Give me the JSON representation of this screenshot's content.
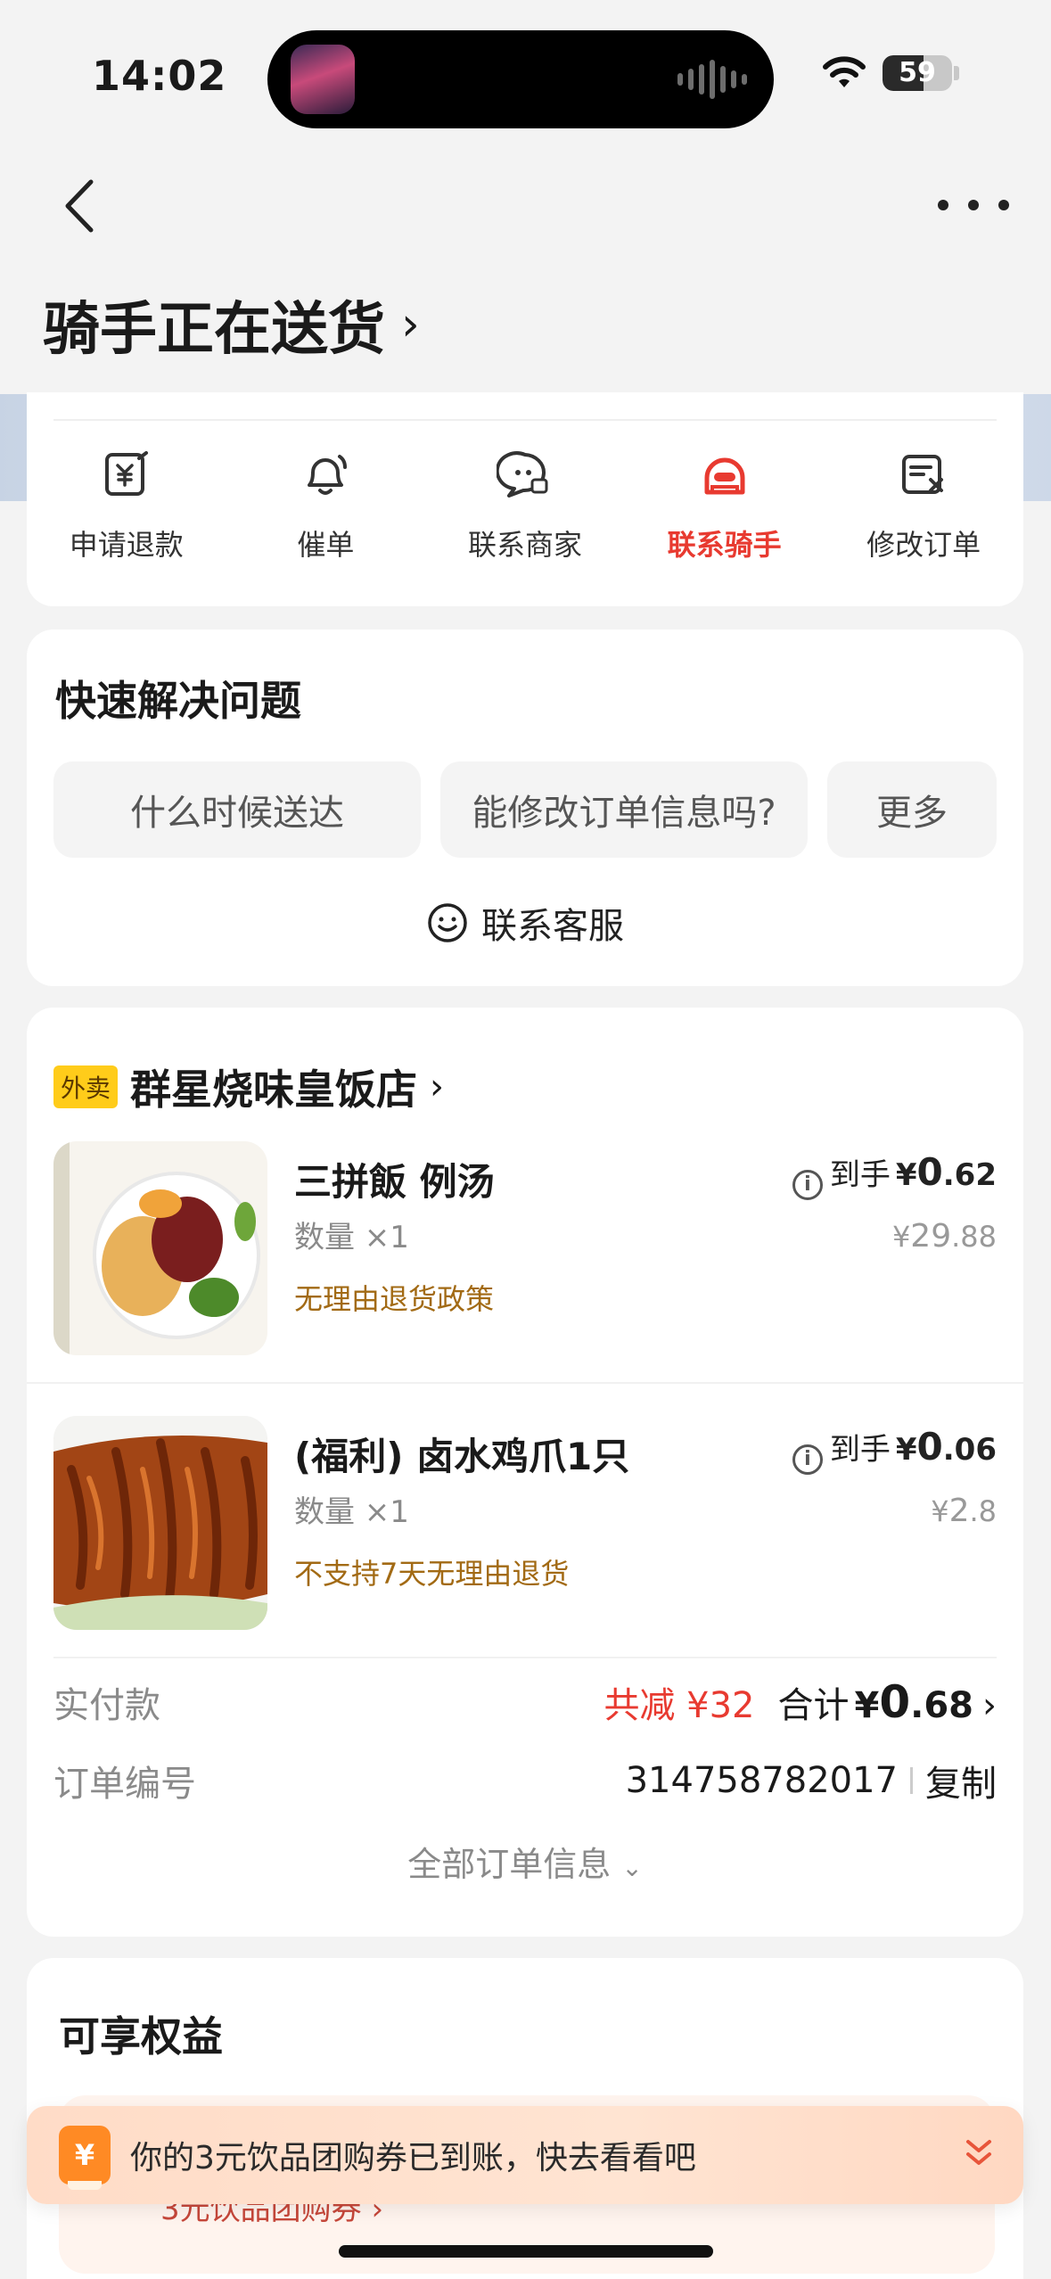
{
  "status_bar": {
    "time": "14:02",
    "battery": "59",
    "battery_level_percent": 59
  },
  "header": {
    "title": "骑手正在送货",
    "title_chevron": "›"
  },
  "actions": [
    {
      "label": "申请退款",
      "icon": "refund-icon"
    },
    {
      "label": "催单",
      "icon": "bell-icon"
    },
    {
      "label": "联系商家",
      "icon": "merchant-chat-icon"
    },
    {
      "label": "联系骑手",
      "icon": "rider-icon",
      "active": true
    },
    {
      "label": "修改订单",
      "icon": "edit-order-icon"
    }
  ],
  "quick": {
    "title": "快速解决问题",
    "pills": [
      "什么时候送达",
      "能修改订单信息吗?",
      "更多"
    ],
    "service_label": "联系客服"
  },
  "order": {
    "tag": "外卖",
    "store_name": "群星烧味皇饭店",
    "items": [
      {
        "name": "三拼飯 例汤",
        "qty": "数量 ×1",
        "policy": "无理由退货政策",
        "price_prefix": "到手",
        "price_yen": "¥",
        "price_int": "0",
        "price_dec": ".62",
        "orig_yen": "¥",
        "orig_int": "29",
        "orig_dec": ".88"
      },
      {
        "name": "(福利) 卤水鸡爪1只",
        "qty": "数量 ×1",
        "policy": "不支持7天无理由退货",
        "price_prefix": "到手",
        "price_yen": "¥",
        "price_int": "0",
        "price_dec": ".06",
        "orig_yen": "¥",
        "orig_int": "2",
        "orig_dec": ".8"
      }
    ],
    "paid_label": "实付款",
    "discount": "共减 ¥32",
    "total_label": "合计",
    "total_yen": "¥",
    "total_int": "0",
    "total_dec": ".68",
    "order_no_label": "订单编号",
    "order_no": "314758782017",
    "copy_label": "复制",
    "all_info_label": "全部订单信息"
  },
  "rights": {
    "title": "可享权益",
    "coupon_peek": "3元饮品团购券 ›"
  },
  "banner": {
    "icon_text": "¥",
    "text": "你的3元饮品团购券已到账，快去看看吧"
  },
  "colors": {
    "accent_red": "#e83a30",
    "policy_brown": "#a26a14",
    "tag_yellow": "#ffcc1a",
    "banner_orange": "#ff8a24"
  }
}
